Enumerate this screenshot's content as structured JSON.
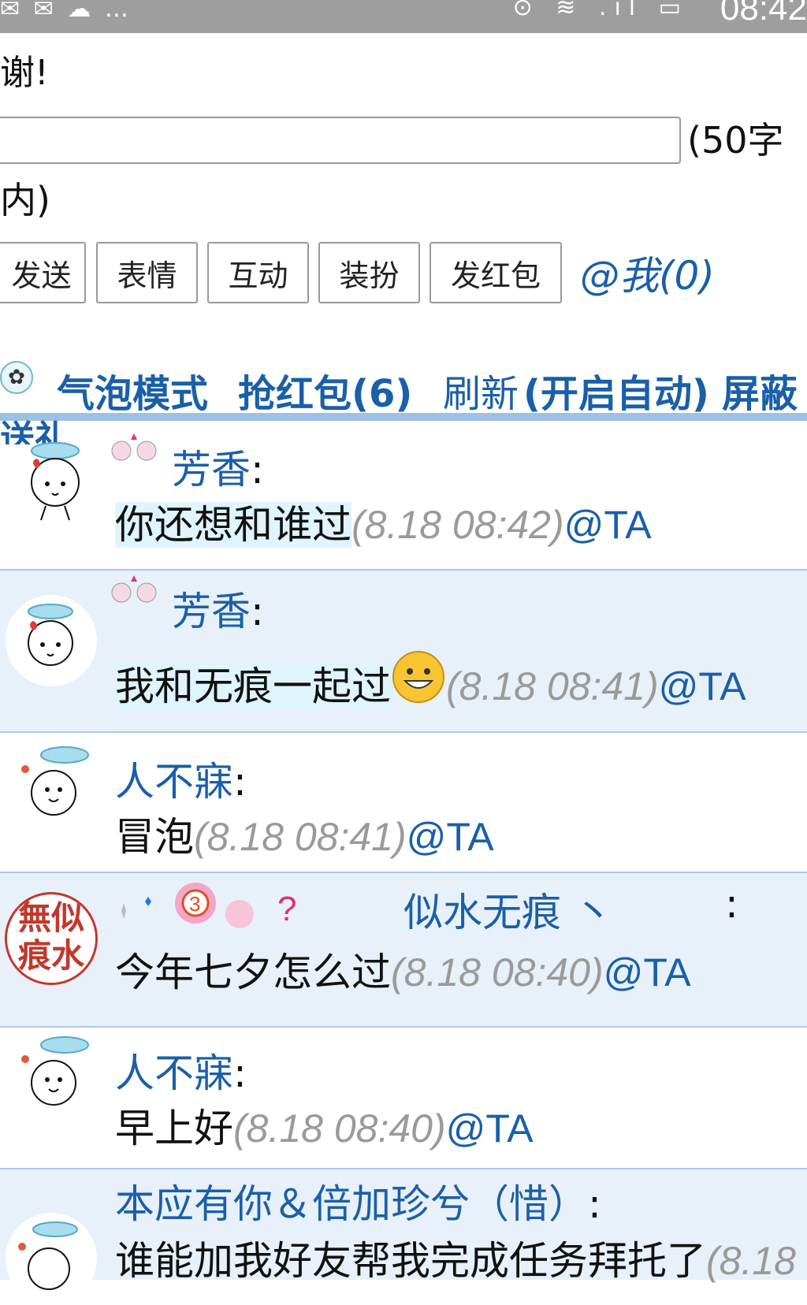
{
  "status_bar": {
    "left_icons": "✉ ✉ ☁ …",
    "right_icons": "⊙ ≋ .ıl ▭",
    "time": "08:42"
  },
  "top_text": "谢!",
  "input": {
    "value": "",
    "limit_part1": "(50字",
    "limit_part2": "内)"
  },
  "buttons": {
    "send": "发送",
    "emoji": "表情",
    "interact": "互动",
    "dressup": "装扮",
    "redpacket": "发红包"
  },
  "at_me": "@我(0)",
  "modebar": {
    "bubble_mode": "气泡模式",
    "grab_redpacket": "抢红包(6)",
    "refresh": "刷新",
    "auto": "(开启自动)",
    "block": "屏蔽",
    "gift": "送礼"
  },
  "messages": [
    {
      "name": "芳香",
      "colon": ":",
      "text": "你还想和谁过",
      "time": "(8.18 08:42)",
      "at": "@TA"
    },
    {
      "name": "芳香",
      "colon": ":",
      "text": "我和无痕一起过",
      "time": "(8.18 08:41)",
      "at": "@TA"
    },
    {
      "name": "人不寐",
      "colon": ":",
      "text": "冒泡",
      "time": "(8.18 08:41)",
      "at": "@TA"
    },
    {
      "name": "似水无痕 丶",
      "colon": ":",
      "text": "今年七夕怎么过",
      "time": "(8.18 08:40)",
      "at": "@TA",
      "avatar_text": "無似痕水",
      "badge": "3"
    },
    {
      "name": "人不寐",
      "colon": ":",
      "text": "早上好",
      "time": "(8.18 08:40)",
      "at": "@TA"
    },
    {
      "name": "本应有你＆倍加珍兮（惜）",
      "colon": ":",
      "text": "谁能加我好友帮我完成任务拜托了",
      "time": "(8.18",
      "at": ""
    }
  ],
  "colors": {
    "link": "#1a5fa8",
    "row_alt": "#e8f0f9",
    "rule": "#9cc0e6",
    "time": "#9a9a9a"
  }
}
